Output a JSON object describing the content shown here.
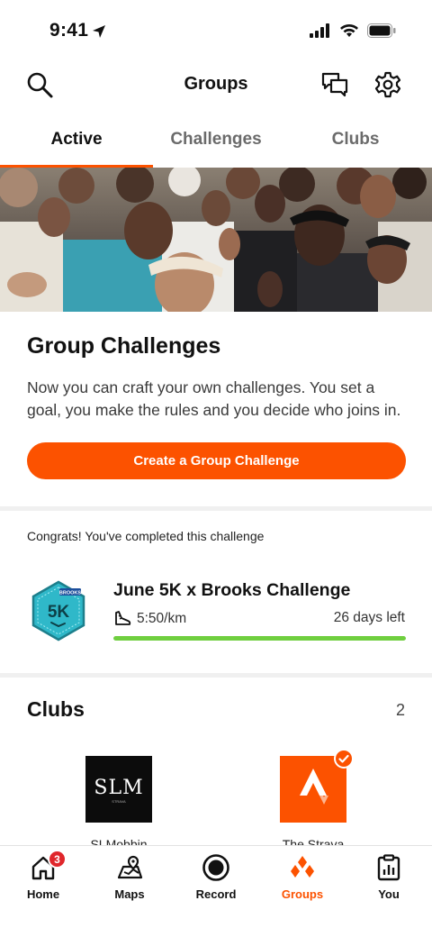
{
  "status_bar": {
    "time": "9:41"
  },
  "header": {
    "title": "Groups"
  },
  "tabs": [
    {
      "label": "Active",
      "active": true
    },
    {
      "label": "Challenges",
      "active": false
    },
    {
      "label": "Clubs",
      "active": false
    }
  ],
  "promo": {
    "title": "Group Challenges",
    "description": "Now you can craft your own challenges. You set a goal, you make the rules and you decide who joins in.",
    "button_label": "Create a Group Challenge"
  },
  "completed_challenge": {
    "congrats_text": "Congrats! You've completed this challenge",
    "name": "June 5K x Brooks Challenge",
    "pace": "5:50/km",
    "days_left": "26 days left",
    "progress": 1.0,
    "badge_text": "5K",
    "badge_brand": "BROOKS"
  },
  "clubs": {
    "title": "Clubs",
    "count": "2",
    "items": [
      {
        "name": "SLMobbin",
        "logo_text": "SLM",
        "logo_sub": "STRAVA"
      },
      {
        "name": "The Strava",
        "verified": true
      }
    ]
  },
  "bottom_nav": [
    {
      "label": "Home",
      "icon": "home-icon",
      "badge": "3"
    },
    {
      "label": "Maps",
      "icon": "map-icon"
    },
    {
      "label": "Record",
      "icon": "record-icon"
    },
    {
      "label": "Groups",
      "icon": "groups-icon",
      "active": true
    },
    {
      "label": "You",
      "icon": "you-icon"
    }
  ],
  "colors": {
    "accent": "#fc5200",
    "progress": "#6fcf3f",
    "badge_red": "#e0262b",
    "badge_teal": "#2fb8c9"
  }
}
